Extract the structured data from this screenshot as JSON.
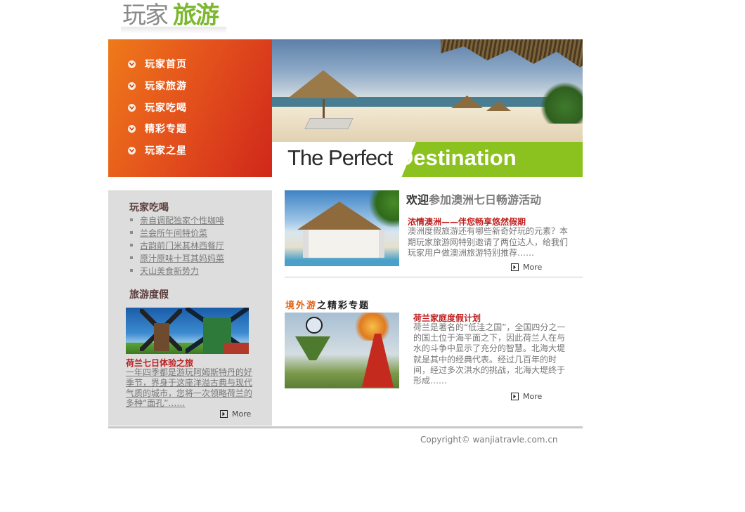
{
  "logo": {
    "part1": "玩家",
    "part2": "旅游"
  },
  "nav": {
    "items": [
      {
        "label": "玩家首页"
      },
      {
        "label": "玩家旅游"
      },
      {
        "label": "玩家吃喝"
      },
      {
        "label": "精彩专题"
      },
      {
        "label": "玩家之星"
      }
    ]
  },
  "banner": {
    "tagline_part1": "The Perfect ",
    "tagline_part2": "Destination"
  },
  "sidebar": {
    "food_title": "玩家吃喝",
    "food_links": [
      {
        "label": "亲自调配独家个性咖啡"
      },
      {
        "label": "兰会所午间特价菜"
      },
      {
        "label": "古韵前门米其林西餐厅"
      },
      {
        "label": "原汁原味十耳其妈妈菜"
      },
      {
        "label": "天山美食新势力"
      }
    ],
    "travel_title": "旅游度假",
    "feature": {
      "headline": "荷兰七日体验之旅",
      "body": "一年四季都是游玩阿姆斯特丹的好季节，界身于这座洋溢古典与现代气质的城市，您将一次领略荷兰的多种“面孔”……",
      "more_label": "More"
    }
  },
  "main": {
    "welcome_part1": "欢迎",
    "welcome_part2": "参加澳洲七日畅游活动",
    "article1": {
      "headline": "浓情澳洲——伴您畅享悠然假期",
      "body": "澳洲度假旅游还有哪些新奇好玩的元素？本期玩家旅游网特别邀请了两位达人，给我们玩家用户做澳洲旅游特别推荐……",
      "more_label": "More"
    },
    "section_title_part1": "境外游",
    "section_title_part2": "之精彩专题",
    "article2": {
      "headline": "荷兰家庭度假计划",
      "body": "荷兰是著名的“低洼之国”，全国四分之一的国土位于海平面之下，因此荷兰人在与水的斗争中显示了充分的智慧。北海大堤就是其中的经典代表。经过几百年的时间，经过多次洪水的挑战，北海大堤终于形成……",
      "more_label": "More"
    }
  },
  "footer": {
    "copyright": "Copyright© wanjiatravle.com.cn"
  },
  "colors": {
    "nav_gradient_start": "#ef7a1a",
    "nav_gradient_end": "#d0271b",
    "banner_green": "#8cc21f",
    "headline_red": "#c01f1f",
    "section_orange": "#e0641a",
    "sidebar_bg": "#dddddd"
  },
  "icons": {
    "nav_bullet": "chevron-down-circle-icon",
    "list_bullet": "square-bullet-icon",
    "more": "arrow-box-icon"
  }
}
